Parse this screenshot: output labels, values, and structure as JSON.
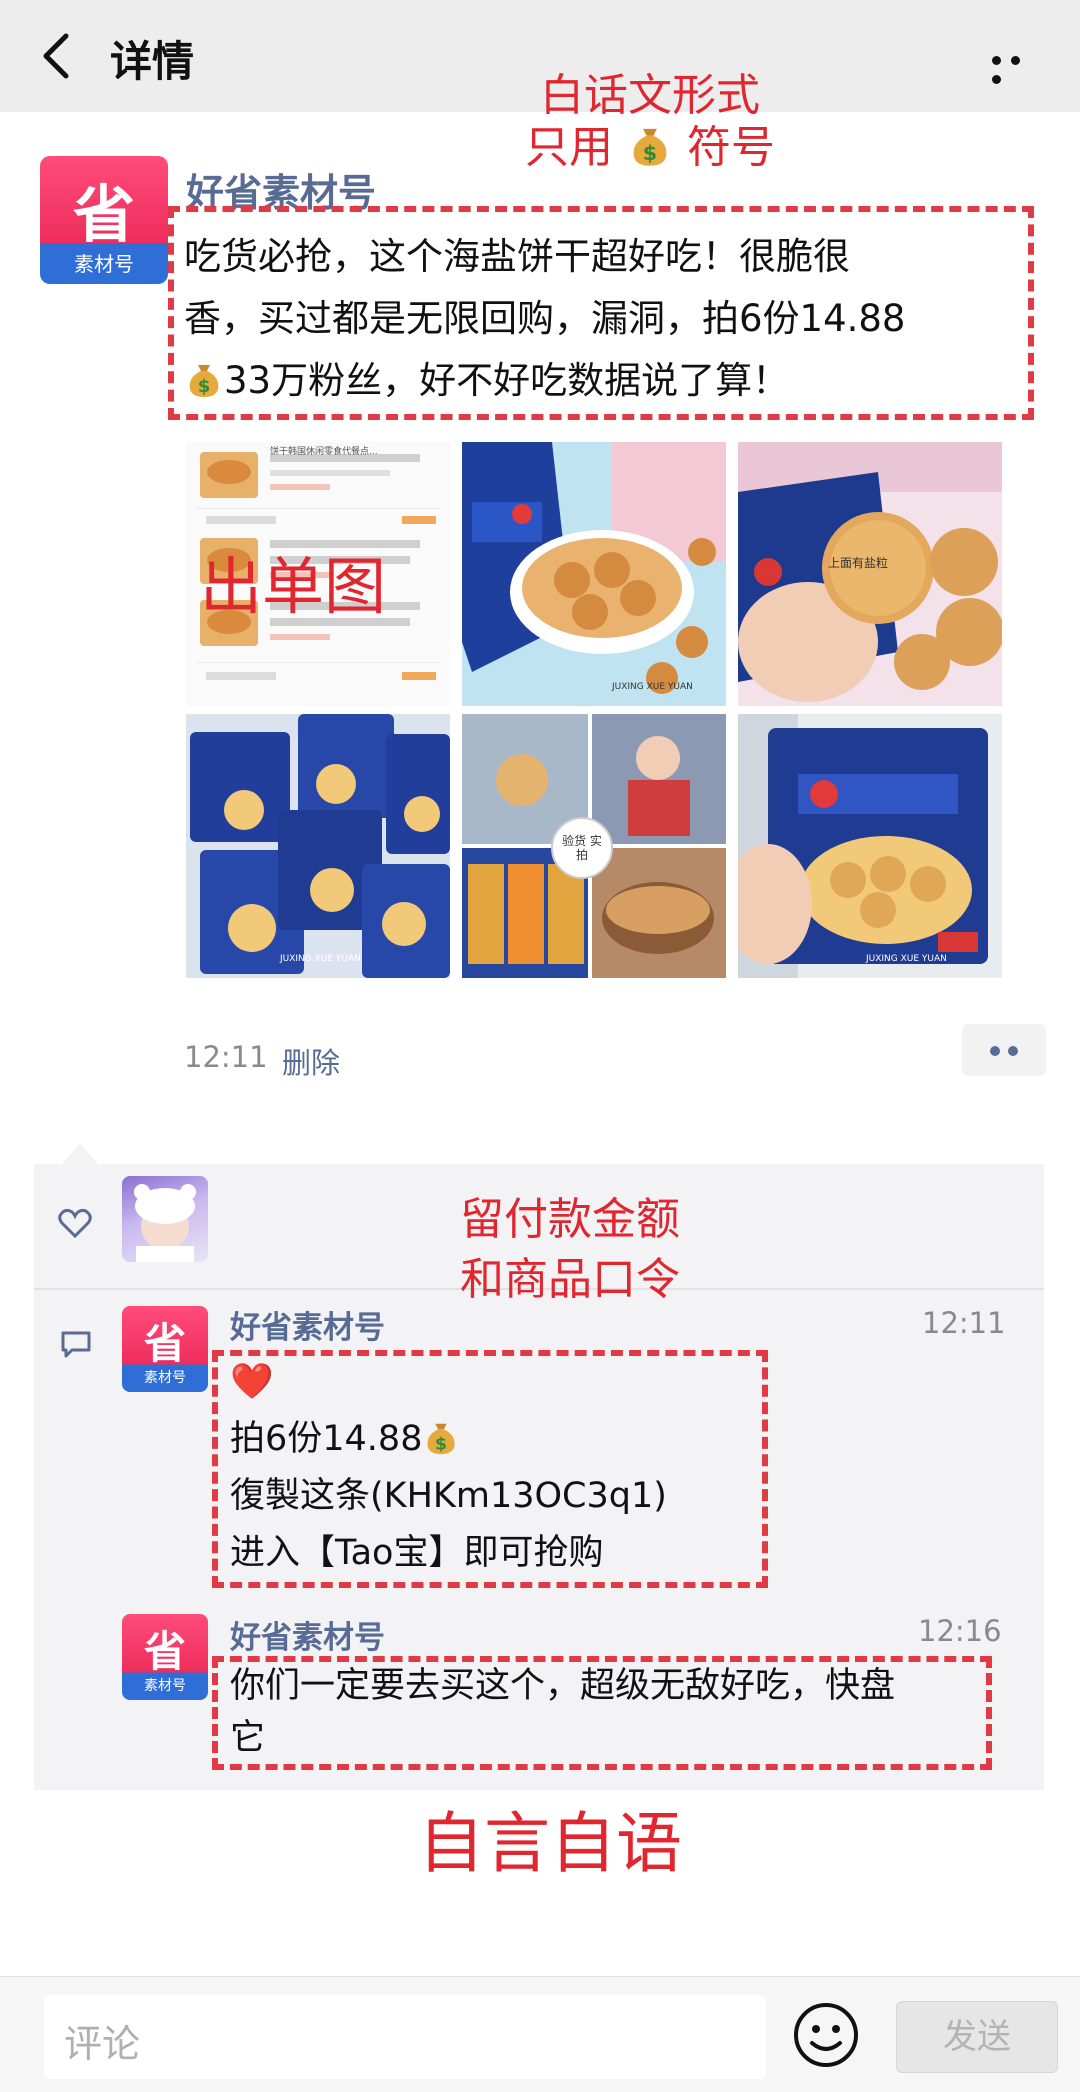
{
  "header": {
    "back_label": "返回",
    "title": "详情"
  },
  "post": {
    "author": "好省素材号",
    "logo_glyph": "省",
    "logo_tag": "素材号",
    "lines": [
      "吃货必抢，这个海盐饼干超好吃！很脆很",
      "香，买过都是无限回购，漏洞，拍6份14.88",
      "33万粉丝，好不好吃数据说了算！"
    ],
    "time": "12:11",
    "delete_label": "删除",
    "images": [
      {
        "name": "order-screenshot",
        "caption": "饼干韩国休闲零食代餐点..."
      },
      {
        "name": "cookies-in-cup",
        "caption": "JUXING XUE YUAN"
      },
      {
        "name": "cookie-in-hand",
        "caption": "上面有盐粒"
      },
      {
        "name": "cookie-bags-pile",
        "caption": "JUXING XUE YUAN"
      },
      {
        "name": "buyer-collage",
        "caption": "验货 实拍"
      },
      {
        "name": "bag-in-hand",
        "caption": "JUXING XUE YUAN"
      }
    ]
  },
  "annotations": {
    "top_line1": "白话文形式",
    "top_line2a": "只用",
    "top_line2b": "符号",
    "image_note": "出单图",
    "comment_note_line1": "留付款金额",
    "comment_note_line2": "和商品口令",
    "bottom_note": "自言自语"
  },
  "comments": [
    {
      "author": "好省素材号",
      "time": "12:11",
      "heart": "❤️",
      "line1": "拍6份14.88",
      "line2": "復製这条(KHKm13OC3q1)",
      "line3": "进入【Tao宝】即可抢购"
    },
    {
      "author": "好省素材号",
      "time": "12:16",
      "line1": "你们一定要去买这个，超级无敌好吃，快盘",
      "line2": "它"
    }
  ],
  "bottom_bar": {
    "placeholder": "评论",
    "send_label": "发送"
  },
  "icons": {
    "back": "chevron-left-icon",
    "more": "more-dots-icon",
    "money": "money-bag-icon",
    "like": "heart-outline-icon",
    "comment": "comment-icon",
    "emoji": "emoji-icon"
  },
  "colors": {
    "link_blue": "#576b95",
    "annotation_red": "#e0262e",
    "dash_red": "#e03a45",
    "header_bg": "#ededed",
    "comment_bg": "#f3f3f5"
  }
}
